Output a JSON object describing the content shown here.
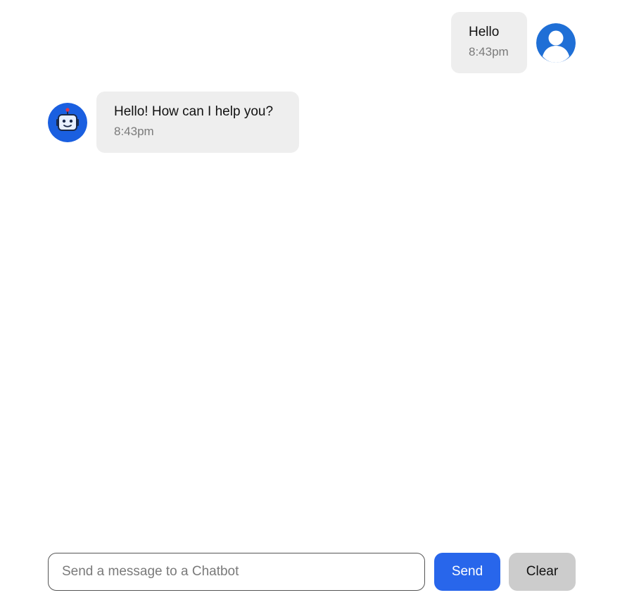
{
  "messages": [
    {
      "sender": "user",
      "text": "Hello",
      "time": "8:43pm",
      "avatar_icon": "user-avatar-icon"
    },
    {
      "sender": "bot",
      "text": "Hello! How can I help you?",
      "time": "8:43pm",
      "avatar_icon": "robot-avatar-icon"
    }
  ],
  "composer": {
    "placeholder": "Send a message to a Chatbot",
    "value": "",
    "send_label": "Send",
    "clear_label": "Clear"
  },
  "colors": {
    "accent": "#2866eb",
    "bubble": "#eeeeee",
    "user_avatar": "#1f6fd6",
    "bot_avatar": "#1a5fe0",
    "clear_button": "#cccccc"
  }
}
